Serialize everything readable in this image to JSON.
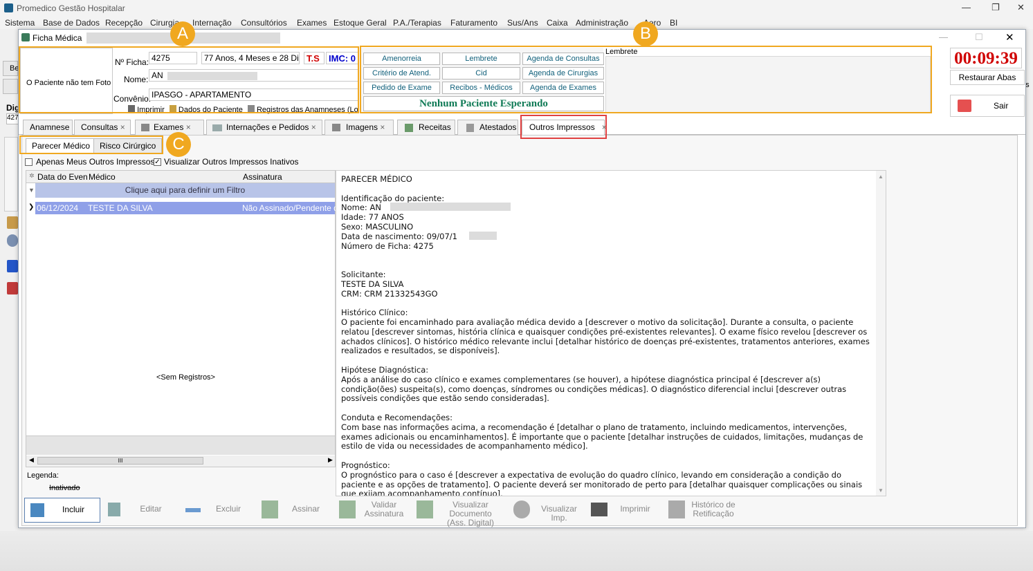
{
  "app": {
    "title": "Promedico Gestão Hospitalar"
  },
  "menu": [
    "Sistema",
    "Base de Dados",
    "Recepção",
    "Cirurgia",
    "Internação",
    "Consultórios",
    "Exames",
    "Estoque Geral",
    "P.A./Terapias",
    "Faturamento",
    "Sus/Ans",
    "Caixa",
    "Administração",
    "Aero",
    "BI"
  ],
  "window": {
    "title": "Ficha Médica"
  },
  "patient": {
    "photo_text": "O Paciente não tem Foto",
    "ficha_label": "Nº Ficha:",
    "ficha_value": "4275",
    "age": "77 Anos, 4 Meses e 28 Dias",
    "ts": "T.S",
    "imc": "IMC: 0",
    "name_label": "Nome:",
    "name_value": "AN",
    "convenio_label": "Convênio:",
    "convenio_value": "IPASGO - APARTAMENTO",
    "actions": [
      "Imprimir",
      "Dados do Paciente",
      "Registros das Anamneses (Log)"
    ]
  },
  "quick_buttons": [
    "Amenorreia",
    "Lembrete",
    "Agenda de Consultas",
    "Critério de Atend.",
    "Cid",
    "Agenda de Cirurgias",
    "Pedido de Exame",
    "Recibos - Médicos",
    "Agenda de Exames"
  ],
  "waiting": "Nenhum Paciente Esperando",
  "lembrete_label": "Lembrete",
  "timer": "00:09:39",
  "restaurar_abas": "Restaurar Abas",
  "sair": "Sair",
  "left_stubs": {
    "be": "Be",
    "dig": "Dig",
    "num": "427",
    "as": "as",
    "c": "C"
  },
  "tabs": [
    {
      "label": "Anamnese",
      "close": ""
    },
    {
      "label": "Consultas",
      "close": "×"
    },
    {
      "label": "Exames",
      "close": "×"
    },
    {
      "label": "Internações e Pedidos",
      "close": "×"
    },
    {
      "label": "Imagens",
      "close": "×"
    },
    {
      "label": "Receitas",
      "close": ""
    },
    {
      "label": "Atestados",
      "close": ""
    },
    {
      "label": "Outros Impressos",
      "close": "×"
    }
  ],
  "subtabs": [
    "Parecer Médico",
    "Risco Cirúrgico"
  ],
  "filters": {
    "only_mine": "Apenas Meus Outros Impressos",
    "show_inactive": "Visualizar Outros Impressos Inativos",
    "show_inactive_checked": "✓"
  },
  "grid": {
    "columns": [
      "Data do Even",
      "Médico",
      "Assinatura"
    ],
    "filter_row": "Clique aqui para definir um Filtro",
    "rows": [
      [
        "06/12/2024",
        "TESTE DA SILVA",
        "Não Assinado/Pendente de"
      ]
    ],
    "empty": "<Sem Registros>",
    "scroll_glyph": "III"
  },
  "legend": {
    "label": "Legenda:",
    "inactive": "Inativado"
  },
  "document": {
    "text": "PARECER MÉDICO\n\nIdentificação do paciente:\nNome: AN\nIdade: 77 ANOS\nSexo: MASCULINO\nData de nascimento: 09/07/1\nNúmero de Ficha: 4275\n\n\nSolicitante:\nTESTE DA SILVA\nCRM: CRM 21332543GO\n\nHistórico Clínico:\nO paciente foi encaminhado para avaliação médica devido a [descrever o motivo da solicitação]. Durante a consulta, o paciente relatou [descrever sintomas, história clínica e quaisquer condições pré-existentes relevantes]. O exame físico revelou [descrever os achados clínicos]. O histórico médico relevante inclui [detalhar histórico de doenças pré-existentes, tratamentos anteriores, exames realizados e resultados, se disponíveis].\n\nHipótese Diagnóstica:\nApós a análise do caso clínico e exames complementares (se houver), a hipótese diagnóstica principal é [descrever a(s) condição(ões) suspeita(s), como doenças, síndromes ou condições médicas]. O diagnóstico diferencial inclui [descrever outras possíveis condições que estão sendo consideradas].\n\nConduta e Recomendações:\nCom base nas informações acima, a recomendação é [detalhar o plano de tratamento, incluindo medicamentos, intervenções, exames adicionais ou encaminhamentos]. É importante que o paciente [detalhar instruções de cuidados, limitações, mudanças de estilo de vida ou necessidades de acompanhamento médico].\n\nPrognóstico:\nO prognóstico para o caso é [descrever a expectativa de evolução do quadro clínico, levando em consideração a condição do paciente e as opções de tratamento]. O paciente deverá ser monitorado de perto para [detalhar quaisquer complicações ou sinais que exijam acompanhamento contínuo]."
  },
  "toolbar": [
    {
      "label": "Incluir"
    },
    {
      "label": "Editar"
    },
    {
      "label": "Excluir"
    },
    {
      "label": "Assinar"
    },
    {
      "label": "Validar\nAssinatura"
    },
    {
      "label": "Visualizar Documento\n(Ass. Digital)"
    },
    {
      "label": "Visualizar Imp."
    },
    {
      "label": "Imprimir"
    },
    {
      "label": "Histórico de\nRetificação"
    }
  ],
  "callouts": [
    "A",
    "B",
    "C"
  ],
  "colors": {
    "accent_callout": "#f0a820",
    "timer": "#d00000",
    "selected_row": "#8fa0e8"
  }
}
